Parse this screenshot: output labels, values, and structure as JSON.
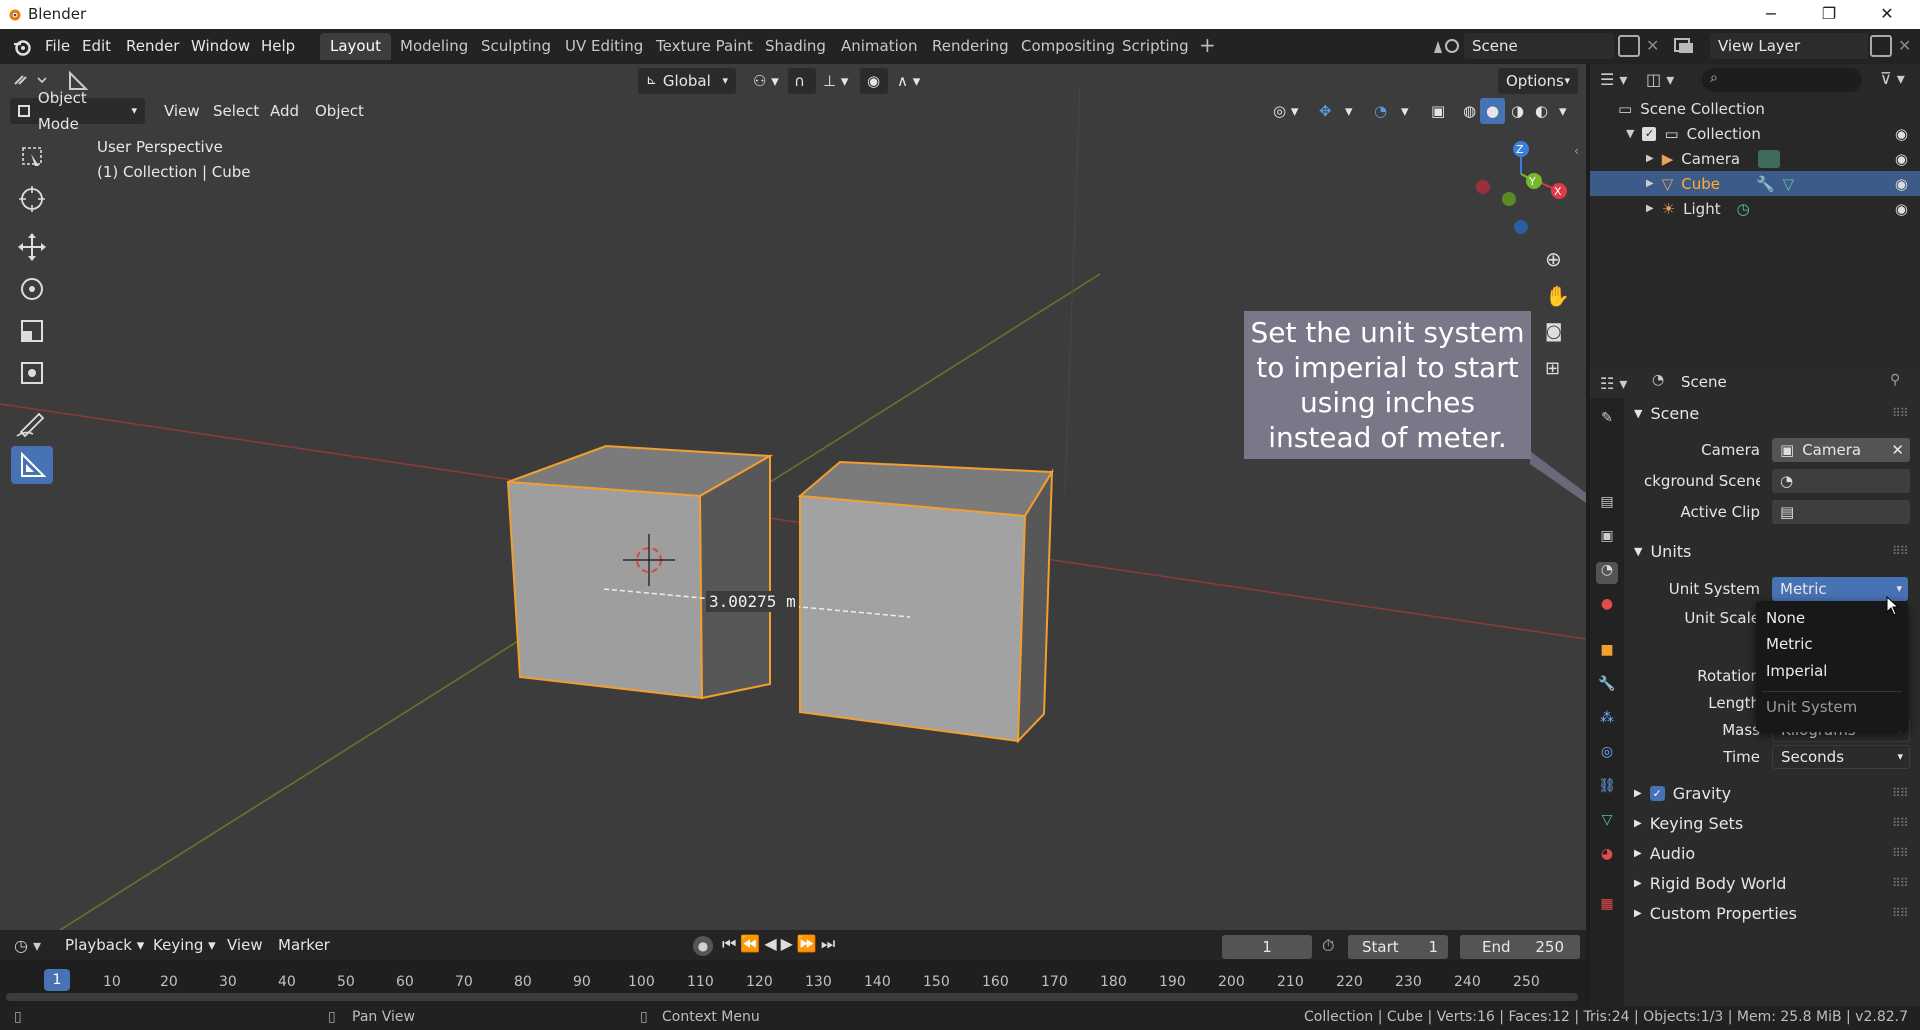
{
  "window": {
    "title": "Blender",
    "min": "−",
    "max": "❐",
    "close": "✕"
  },
  "menu": [
    "File",
    "Edit",
    "Render",
    "Window",
    "Help"
  ],
  "workspaces": [
    "Layout",
    "Modeling",
    "Sculpting",
    "UV Editing",
    "Texture Paint",
    "Shading",
    "Animation",
    "Rendering",
    "Compositing",
    "Scripting"
  ],
  "scene_field": "Scene",
  "view_layer_field": "View Layer",
  "viewport": {
    "mode": "Object Mode",
    "menus": [
      "View",
      "Select",
      "Add",
      "Object"
    ],
    "orientation": "Global",
    "options": "Options",
    "info_line1": "User Perspective",
    "info_line2": "(1) Collection | Cube",
    "measure": "3.00275 m",
    "gizmo": {
      "x": "X",
      "y": "Y",
      "z": "Z"
    }
  },
  "callout": "Set the unit system to imperial to start using inches instead of meter.",
  "outliner": {
    "root": "Scene Collection",
    "items": [
      {
        "label": "Collection"
      },
      {
        "label": "Camera"
      },
      {
        "label": "Cube"
      },
      {
        "label": "Light"
      }
    ]
  },
  "properties": {
    "header": "Scene",
    "scene_section": "Scene",
    "camera_label": "Camera",
    "camera_value": "Camera",
    "background_label": "ckground Scene",
    "clip_label": "Active Clip",
    "units_section": "Units",
    "unit_system_label": "Unit System",
    "unit_system_value": "Metric",
    "unit_scale_label": "Unit Scale",
    "rotation_label": "Rotation",
    "length_label": "Length",
    "mass_label": "Mass",
    "mass_value": "Kilograms",
    "time_label": "Time",
    "time_value": "Seconds",
    "gravity": "Gravity",
    "collapsed": [
      "Keying Sets",
      "Audio",
      "Rigid Body World",
      "Custom Properties"
    ]
  },
  "dropdown": {
    "options": [
      "None",
      "Metric",
      "Imperial"
    ],
    "title": "Unit System"
  },
  "timeline": {
    "menus": [
      "Playback",
      "Keying",
      "View",
      "Marker"
    ],
    "current_frame": "1",
    "start_label": "Start",
    "start_value": "1",
    "end_label": "End",
    "end_value": "250",
    "ticks": [
      "10",
      "20",
      "30",
      "40",
      "50",
      "60",
      "70",
      "80",
      "90",
      "100",
      "110",
      "120",
      "130",
      "140",
      "150",
      "160",
      "170",
      "180",
      "190",
      "200",
      "210",
      "220",
      "230",
      "240",
      "250"
    ]
  },
  "status": {
    "pan": "Pan View",
    "context": "Context Menu",
    "stats": "Collection | Cube | Verts:16 | Faces:12 | Tris:24 | Objects:1/3 | Mem: 25.8 MiB | v2.82.7"
  },
  "colors": {
    "accent": "#4772b3",
    "selected_outline": "#f29f30",
    "callout_bg": "#7a7789"
  }
}
